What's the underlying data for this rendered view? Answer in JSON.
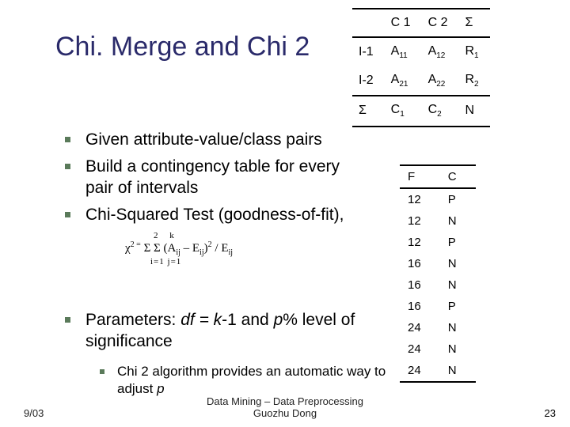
{
  "title": "Chi. Merge and Chi 2",
  "bullets": {
    "b1": "Given attribute-value/class pairs",
    "b2": "Build a contingency table for every pair of  intervals",
    "b3": "Chi-Squared Test (goodness-of-fit),"
  },
  "formula": {
    "top_limits": "2 k",
    "line_html": "χ<sup>2 =</sup> Σ Σ  (A<sub>ij</sub> – E<sub>ij</sub>)<sup>2</sup> / E<sub>ij</sub>",
    "bot_limits": "i=1 j=1"
  },
  "params_bullet_html": "Parameters: <span class=\"ital\">df  =  k</span>-1 and <span class=\"ital\">p</span>% level of significance",
  "sub_bullet_html": "Chi 2 algorithm provides an automatic way to adjust <span class=\"ital\">p</span>",
  "footer": {
    "date": "9/03",
    "center1": "Data Mining – Data Preprocessing",
    "center2": "Guozhu Dong",
    "page": "23"
  },
  "table1": {
    "head": [
      "",
      "C 1",
      "C 2",
      "Σ"
    ],
    "rows": [
      [
        "I-1",
        "A<span class=\"subscr\">11</span>",
        "A<span class=\"subscr\">12</span>",
        "R<span class=\"subscr\">1</span>"
      ],
      [
        "I-2",
        "A<span class=\"subscr\">21</span>",
        "A<span class=\"subscr\">22</span>",
        "R<span class=\"subscr\">2</span>"
      ]
    ],
    "foot": [
      "Σ",
      "C<span class=\"subscr\">1</span>",
      "C<span class=\"subscr\">2</span>",
      "N"
    ]
  },
  "table2": {
    "head": [
      "F",
      "C"
    ],
    "rows": [
      [
        "12",
        "P"
      ],
      [
        "12",
        "N"
      ],
      [
        "12",
        "P"
      ],
      [
        "16",
        "N"
      ],
      [
        "16",
        "N"
      ],
      [
        "16",
        "P"
      ],
      [
        "24",
        "N"
      ],
      [
        "24",
        "N"
      ],
      [
        "24",
        "N"
      ]
    ]
  }
}
